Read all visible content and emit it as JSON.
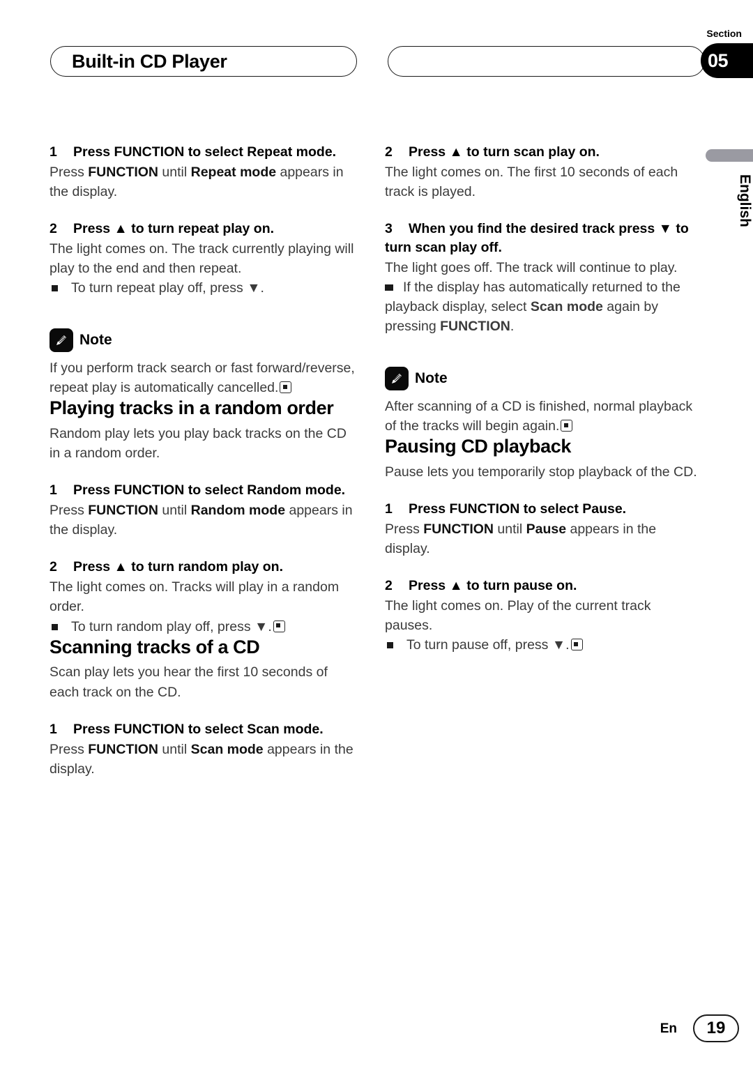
{
  "header": {
    "chapter_title": "Built-in CD Player",
    "second_box_text": "",
    "section_label": "Section",
    "section_number": "05"
  },
  "side_tab": {
    "language": "English"
  },
  "left_column": {
    "repeat_step1": {
      "num": "1",
      "head": "Press FUNCTION to select Repeat mode.",
      "body_pre": "Press ",
      "body_b1": "FUNCTION",
      "body_mid": " until ",
      "body_b2": "Repeat mode",
      "body_post": " appears in the display."
    },
    "repeat_step2": {
      "num": "2",
      "head": "Press ▲ to turn repeat play on.",
      "body": "The light comes on. The track currently playing will play to the end and then repeat.",
      "bullet": "To turn repeat play off, press ▼."
    },
    "note1": {
      "label": "Note",
      "icon": "pencil-icon",
      "text": "If you perform track search or fast forward/reverse, repeat play is automatically cancelled."
    },
    "random_heading": "Playing tracks in a random order",
    "random_intro": "Random play lets you play back tracks on the CD in a random order.",
    "random_step1": {
      "num": "1",
      "head": "Press FUNCTION to select Random mode.",
      "body_pre": "Press ",
      "body_b1": "FUNCTION",
      "body_mid": " until ",
      "body_b2": "Random mode",
      "body_post": " appears in the display."
    },
    "random_step2": {
      "num": "2",
      "head": "Press ▲ to turn random play on.",
      "body": "The light comes on. Tracks will play in a random order.",
      "bullet": "To turn random play off, press ▼."
    },
    "scan_heading": "Scanning tracks of a CD",
    "scan_intro": "Scan play lets you hear the first 10 seconds of each track on the CD.",
    "scan_step1": {
      "num": "1",
      "head": "Press FUNCTION to select Scan mode.",
      "body_pre": "Press ",
      "body_b1": "FUNCTION",
      "body_mid": " until ",
      "body_b2": "Scan mode",
      "body_post": " appears in the display."
    }
  },
  "right_column": {
    "scan_step2": {
      "num": "2",
      "head": "Press ▲ to turn scan play on.",
      "body": "The light comes on. The first 10 seconds of each track is played."
    },
    "scan_step3": {
      "num": "3",
      "head": "When you find the desired track press ▼ to turn scan play off.",
      "body": "The light goes off. The track will continue to play.",
      "bullet_pre": "If the display has automatically returned to the playback display, select ",
      "bullet_b1": "Scan mode",
      "bullet_mid": " again by pressing ",
      "bullet_b2": "FUNCTION",
      "bullet_post": "."
    },
    "note2": {
      "label": "Note",
      "icon": "pencil-icon",
      "text": "After scanning of a CD is finished, normal playback of the tracks will begin again."
    },
    "pause_heading": "Pausing CD playback",
    "pause_intro": "Pause lets you temporarily stop playback of the CD.",
    "pause_step1": {
      "num": "1",
      "head": "Press FUNCTION to select Pause.",
      "body_pre": "Press ",
      "body_b1": "FUNCTION",
      "body_mid": " until ",
      "body_b2": "Pause",
      "body_post": " appears in the display."
    },
    "pause_step2": {
      "num": "2",
      "head": "Press ▲ to turn pause on.",
      "body": "The light comes on. Play of the current track pauses.",
      "bullet": "To turn pause off, press ▼."
    }
  },
  "footer": {
    "language_code": "En",
    "page_number": "19"
  },
  "colors": {
    "text": "#3b3b3b",
    "heading": "#000000",
    "side_tab_bar": "#9a9aa2",
    "badge_bg": "#000000"
  }
}
